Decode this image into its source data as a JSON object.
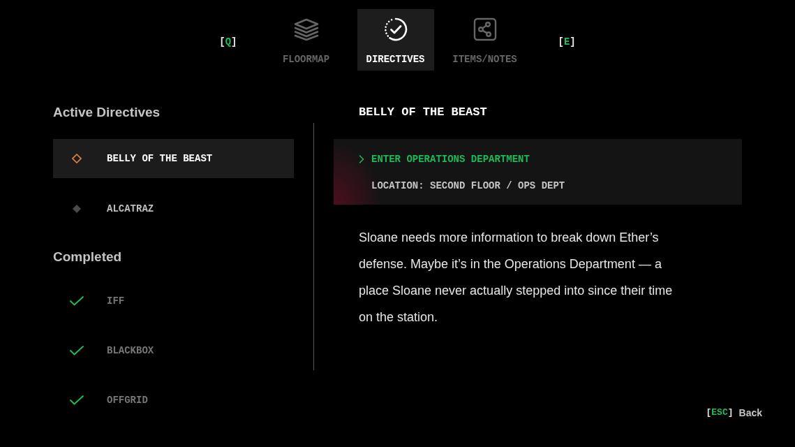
{
  "nav": {
    "prev_key": {
      "open": "[",
      "key": "Q",
      "close": "]"
    },
    "tabs": [
      {
        "label": "FLOORMAP",
        "selected": false
      },
      {
        "label": "DIRECTIVES",
        "selected": true
      },
      {
        "label": "ITEMS/NOTES",
        "selected": false
      }
    ],
    "next_key": {
      "open": "[",
      "key": "E",
      "close": "]"
    }
  },
  "active_directives": {
    "heading": "Active Directives",
    "items": [
      {
        "name": "BELLY OF THE BEAST",
        "selected": true
      },
      {
        "name": "ALCATRAZ",
        "selected": false
      }
    ]
  },
  "completed": {
    "heading": "Completed",
    "items": [
      {
        "name": "IFF"
      },
      {
        "name": "BLACKBOX"
      },
      {
        "name": "OFFGRID"
      }
    ]
  },
  "detail": {
    "title": "BELLY OF THE BEAST",
    "objective": "ENTER OPERATIONS DEPARTMENT",
    "location": "LOCATION: SECOND FLOOR / OPS DEPT",
    "description": "Sloane needs more information to break down Ether’s defense. Maybe it’s in the Operations Department — a place Sloane never actually stepped into since their time on the station."
  },
  "footer": {
    "back": {
      "open": "[",
      "key": "ESC",
      "close": "]",
      "label": "Back"
    }
  }
}
